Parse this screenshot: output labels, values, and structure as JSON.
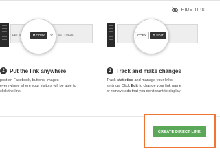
{
  "header": {
    "hide_tips_label": "HIDE TIPS"
  },
  "illustrations": {
    "left": {
      "lbl_a": "LET'S",
      "copy_label": "COPY",
      "lbl_b": "SETTINGS"
    },
    "right": {
      "copy_label": "COPY",
      "edit_label": "EDIT"
    }
  },
  "steps": [
    {
      "number": "2",
      "title": "Put the link anywhere",
      "desc_lines": [
        "post on Facebook, buttons, images —",
        "everywhere where your visitors will be able to",
        "click the link"
      ]
    },
    {
      "number": "3",
      "title": "Track and make changes",
      "desc_line1_pre": "Track ",
      "desc_line1_bold": "statistics",
      "desc_line1_post": " and manage your links",
      "desc_line2_pre": "settings. Click ",
      "desc_line2_bold": "Edit",
      "desc_line2_post": " to change your link name",
      "desc_line3": "or remove ads that you don't want to display"
    }
  ],
  "footer": {
    "cta_label": "CREATE DIRECT LINK",
    "cta_color": "#5ba858",
    "highlight_color": "#f07532"
  }
}
